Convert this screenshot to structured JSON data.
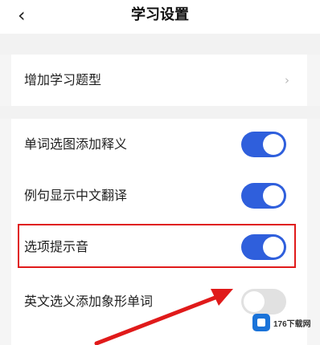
{
  "header": {
    "back_glyph": "‹",
    "title": "学习设置"
  },
  "sections": [
    {
      "items": [
        {
          "label": "增加学习题型",
          "control": "chevron",
          "glyph": "›"
        }
      ]
    },
    {
      "items": [
        {
          "label": "单词选图添加释义",
          "control": "toggle",
          "on": true
        },
        {
          "label": "例句显示中文翻译",
          "control": "toggle",
          "on": true
        },
        {
          "label": "选项提示音",
          "control": "toggle",
          "on": true,
          "highlighted": true
        },
        {
          "label": "英文选义添加象形单词",
          "control": "toggle",
          "on": false
        }
      ]
    }
  ],
  "annotation": {
    "highlight_color": "#e01a1a",
    "arrow_color": "#e01a1a"
  },
  "watermark": {
    "text": "176下载网",
    "logo_color": "#1a73d9"
  },
  "colors": {
    "toggle_on": "#2f5fdc",
    "toggle_off": "#e1e1e1",
    "background": "#f5f5f5"
  }
}
